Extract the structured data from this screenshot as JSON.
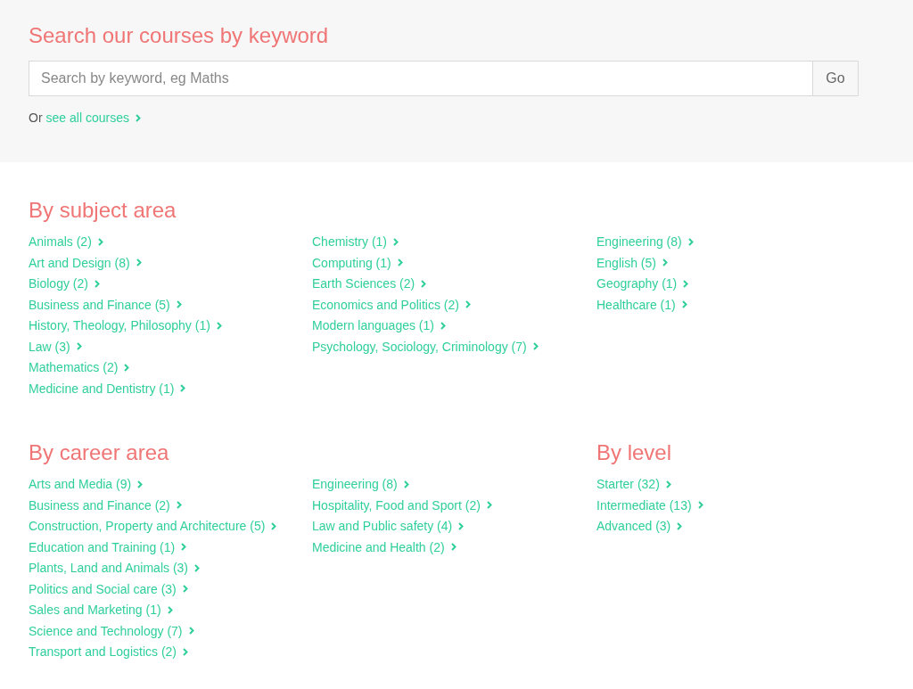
{
  "search": {
    "title": "Search our courses by keyword",
    "placeholder": "Search by keyword, eg Maths",
    "button": "Go",
    "prefix": "Or",
    "link": "see all courses"
  },
  "rows": [
    [
      {
        "title": "By subject area",
        "columns": [
          [
            "Animals (2)",
            "Art and Design (8)",
            "Biology (2)",
            "Business and Finance (5)",
            "History, Theology, Philosophy (1)",
            "Law (3)",
            "Mathematics (2)",
            "Medicine and Dentistry (1)"
          ],
          [
            "Chemistry (1)",
            "Computing (1)",
            "Earth Sciences (2)",
            "Economics and Politics (2)",
            "Modern languages (1)",
            "Psychology, Sociology, Criminology (7)"
          ],
          [
            "Engineering (8)",
            "English (5)",
            "Geography (1)",
            "Healthcare (1)"
          ]
        ]
      }
    ],
    [
      {
        "title": "By career area",
        "columns": [
          [
            "Arts and Media (9)",
            "Business and Finance (2)",
            "Construction, Property and Architecture (5)",
            "Education and Training (1)",
            "Plants, Land and Animals (3)",
            "Politics and Social care (3)",
            "Sales and Marketing (1)",
            "Science and Technology (7)",
            "Transport and Logistics (2)"
          ],
          [
            "Engineering (8)",
            "Hospitality, Food and Sport (2)",
            "Law and Public safety (4)",
            "Medicine and Health (2)"
          ]
        ]
      },
      {
        "title": "By level",
        "columns": [
          [
            "Starter (32)",
            "Intermediate (13)",
            "Advanced (3)"
          ]
        ]
      }
    ]
  ]
}
